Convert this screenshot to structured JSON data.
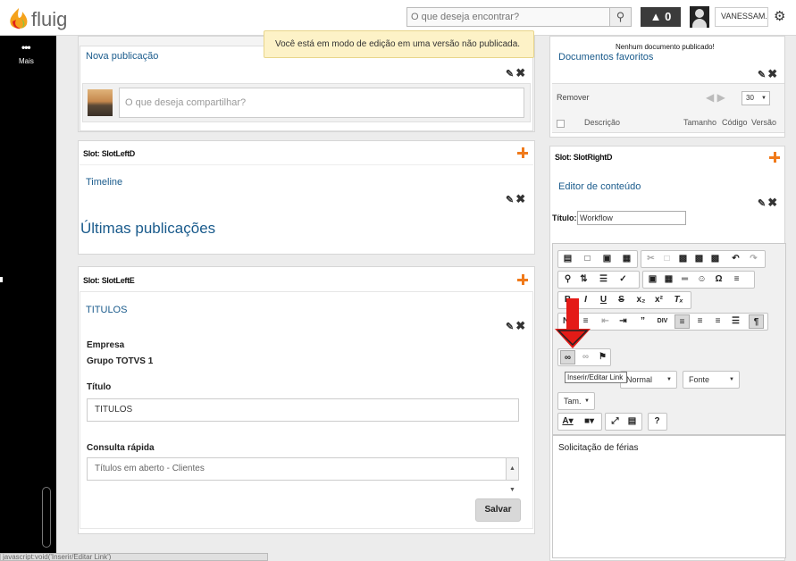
{
  "header": {
    "logo_text": "fluig",
    "search_placeholder": "O que deseja encontrar?",
    "alert_count": "0",
    "user_name": "VANESSAM.",
    "icons": [
      "search-icon",
      "alert-icon",
      "avatar-icon",
      "gear-icon"
    ]
  },
  "sidebar": {
    "more_label": "Mais"
  },
  "notice": "Você está em modo de edição em uma versão não publicada.",
  "left": {
    "slot_a": {
      "widget_title": "Nova publicação",
      "share_placeholder": "O que deseja compartilhar?"
    },
    "slot_d": {
      "label": "Slot: SlotLeftD",
      "widget_title": "Timeline",
      "heading": "Últimas publicações"
    },
    "slot_e": {
      "label": "Slot: SlotLeftE",
      "widget_title": "TITULOS",
      "empresa_label": "Empresa",
      "empresa_value": "Grupo TOTVS 1",
      "titulo_label": "Título",
      "titulo_value": "TITULOS",
      "consulta_label": "Consulta rápida",
      "consulta_value": "Títulos em aberto - Clientes",
      "save_label": "Salvar"
    }
  },
  "right": {
    "favorites": {
      "note": "Nenhum documento publicado!",
      "widget_title": "Documentos favoritos",
      "remove_label": "Remover",
      "page_size": "30",
      "columns": [
        "Descrição",
        "Tamanho",
        "Código",
        "Versão"
      ]
    },
    "slot_d": {
      "label": "Slot: SlotRightD",
      "widget_title": "Editor de conteúdo",
      "title_label": "Título:",
      "title_value": "Workflow",
      "format_combo": "Normal",
      "font_combo": "Fonte",
      "size_combo": "Tam.",
      "tooltip": "Inserir/Editar Link",
      "content_text": "Solicitação de férias"
    }
  },
  "statusbar": "javascript:void('Inserir/Editar Link')",
  "colors": {
    "accent_link": "#1a5b8c",
    "notice_bg": "#fdf2c7",
    "highlight_arrow": "#e41b17",
    "sidebar_bg": "#000000"
  }
}
